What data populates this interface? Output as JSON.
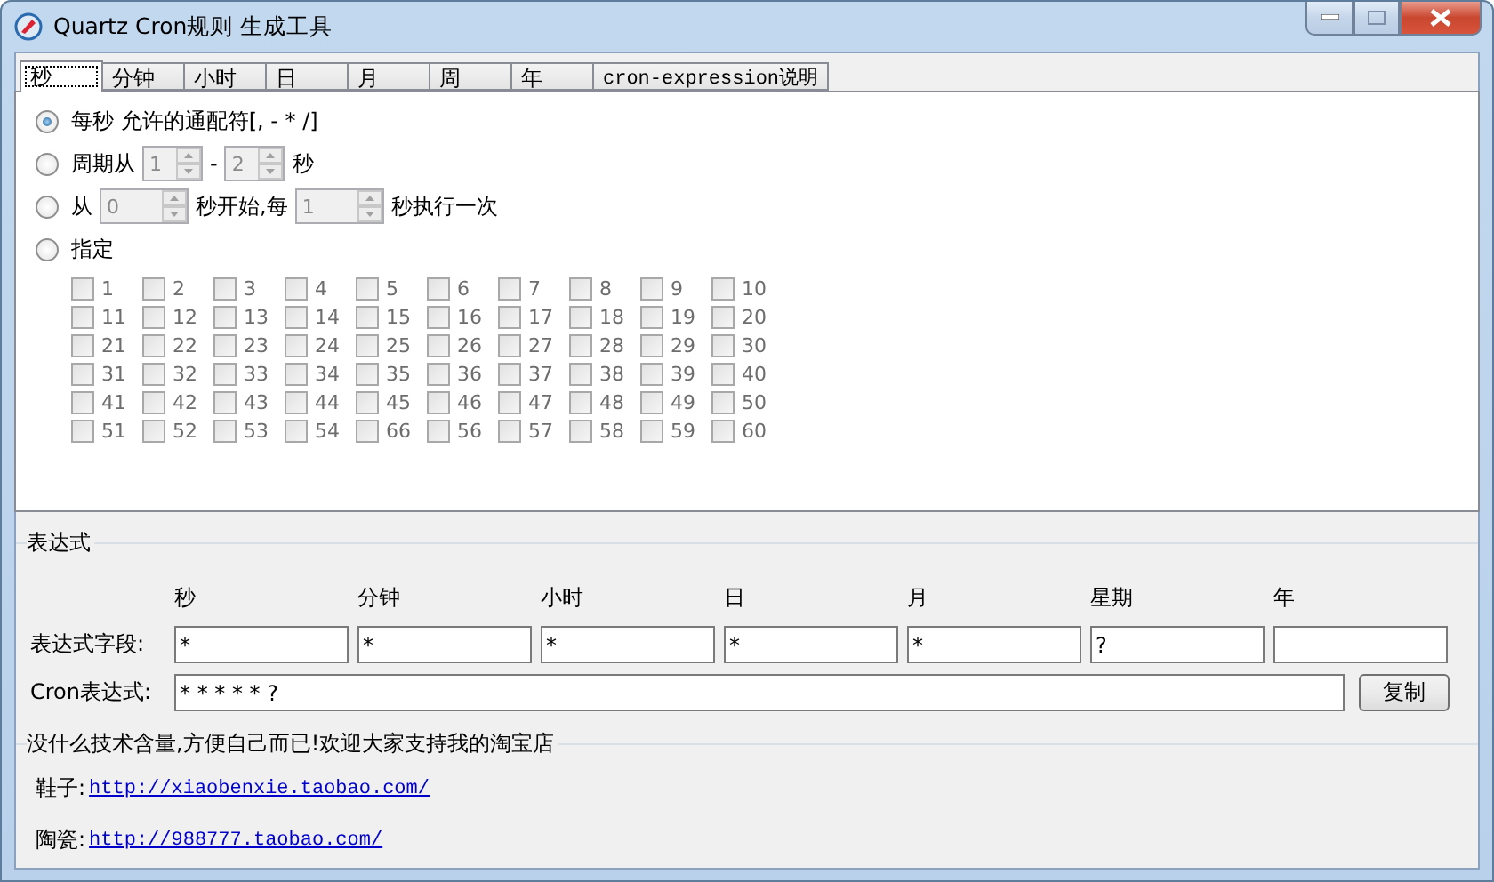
{
  "window": {
    "title": "Quartz Cron规则 生成工具"
  },
  "tabs": [
    {
      "label": "秒",
      "selected": true
    },
    {
      "label": "分钟",
      "selected": false
    },
    {
      "label": "小时",
      "selected": false
    },
    {
      "label": "日",
      "selected": false
    },
    {
      "label": "月",
      "selected": false
    },
    {
      "label": "周",
      "selected": false
    },
    {
      "label": "年",
      "selected": false
    },
    {
      "label": "cron-expression说明",
      "selected": false,
      "kind": "mono"
    }
  ],
  "options": [
    {
      "selected": true,
      "parts": [
        {
          "kind": "text",
          "text": "每秒 允许的通配符[, - * /]"
        }
      ]
    },
    {
      "selected": false,
      "parts": [
        {
          "kind": "text",
          "text": "周期从"
        },
        {
          "kind": "spin",
          "value": "1",
          "disabled": true
        },
        {
          "kind": "text",
          "text": "-"
        },
        {
          "kind": "spin",
          "value": "2",
          "disabled": true
        },
        {
          "kind": "text",
          "text": "秒"
        }
      ]
    },
    {
      "selected": false,
      "parts": [
        {
          "kind": "text",
          "text": "从"
        },
        {
          "kind": "spin",
          "value": "0",
          "disabled": true
        },
        {
          "kind": "text",
          "text": "秒开始,每"
        },
        {
          "kind": "spin",
          "value": "1",
          "disabled": true
        },
        {
          "kind": "text",
          "text": "秒执行一次"
        }
      ]
    },
    {
      "selected": false,
      "parts": [
        {
          "kind": "text",
          "text": "指定"
        }
      ]
    }
  ],
  "specific": {
    "disabled": true,
    "items": [
      {
        "label": "1",
        "checked": false
      },
      {
        "label": "2",
        "checked": false
      },
      {
        "label": "3",
        "checked": false
      },
      {
        "label": "4",
        "checked": false
      },
      {
        "label": "5",
        "checked": false
      },
      {
        "label": "6",
        "checked": false
      },
      {
        "label": "7",
        "checked": false
      },
      {
        "label": "8",
        "checked": false
      },
      {
        "label": "9",
        "checked": false
      },
      {
        "label": "10",
        "checked": false
      },
      {
        "label": "11",
        "checked": false
      },
      {
        "label": "12",
        "checked": false
      },
      {
        "label": "13",
        "checked": false
      },
      {
        "label": "14",
        "checked": false
      },
      {
        "label": "15",
        "checked": false
      },
      {
        "label": "16",
        "checked": false
      },
      {
        "label": "17",
        "checked": false
      },
      {
        "label": "18",
        "checked": false
      },
      {
        "label": "19",
        "checked": false
      },
      {
        "label": "20",
        "checked": false
      },
      {
        "label": "21",
        "checked": false
      },
      {
        "label": "22",
        "checked": false
      },
      {
        "label": "23",
        "checked": false
      },
      {
        "label": "24",
        "checked": false
      },
      {
        "label": "25",
        "checked": false
      },
      {
        "label": "26",
        "checked": false
      },
      {
        "label": "27",
        "checked": false
      },
      {
        "label": "28",
        "checked": false
      },
      {
        "label": "29",
        "checked": false
      },
      {
        "label": "30",
        "checked": false
      },
      {
        "label": "31",
        "checked": false
      },
      {
        "label": "32",
        "checked": false
      },
      {
        "label": "33",
        "checked": false
      },
      {
        "label": "34",
        "checked": false
      },
      {
        "label": "35",
        "checked": false
      },
      {
        "label": "36",
        "checked": false
      },
      {
        "label": "37",
        "checked": false
      },
      {
        "label": "38",
        "checked": false
      },
      {
        "label": "39",
        "checked": false
      },
      {
        "label": "40",
        "checked": false
      },
      {
        "label": "41",
        "checked": false
      },
      {
        "label": "42",
        "checked": false
      },
      {
        "label": "43",
        "checked": false
      },
      {
        "label": "44",
        "checked": false
      },
      {
        "label": "45",
        "checked": false
      },
      {
        "label": "46",
        "checked": false
      },
      {
        "label": "47",
        "checked": false
      },
      {
        "label": "48",
        "checked": false
      },
      {
        "label": "49",
        "checked": false
      },
      {
        "label": "50",
        "checked": false
      },
      {
        "label": "51",
        "checked": false
      },
      {
        "label": "52",
        "checked": false
      },
      {
        "label": "53",
        "checked": false
      },
      {
        "label": "54",
        "checked": false
      },
      {
        "label": "66",
        "checked": false
      },
      {
        "label": "56",
        "checked": false
      },
      {
        "label": "57",
        "checked": false
      },
      {
        "label": "58",
        "checked": false
      },
      {
        "label": "59",
        "checked": false
      },
      {
        "label": "60",
        "checked": false
      }
    ]
  },
  "expression": {
    "legend": "表达式",
    "columns": [
      "秒",
      "分钟",
      "小时",
      "日",
      "月",
      "星期",
      "年"
    ],
    "fields_label": "表达式字段:",
    "fields": [
      "*",
      "*",
      "*",
      "*",
      "*",
      "?"
    ],
    "cron_label": "Cron表达式:",
    "cron_value": "* * * * * ?",
    "copy_button": "复制"
  },
  "footer": {
    "legend": "没什么技术含量,方便自己而已!欢迎大家支持我的淘宝店",
    "links": [
      {
        "label": "鞋子:",
        "url": "http://xiaobenxie.taobao.com/"
      },
      {
        "label": "陶瓷:",
        "url": "http://988777.taobao.com/"
      }
    ]
  }
}
